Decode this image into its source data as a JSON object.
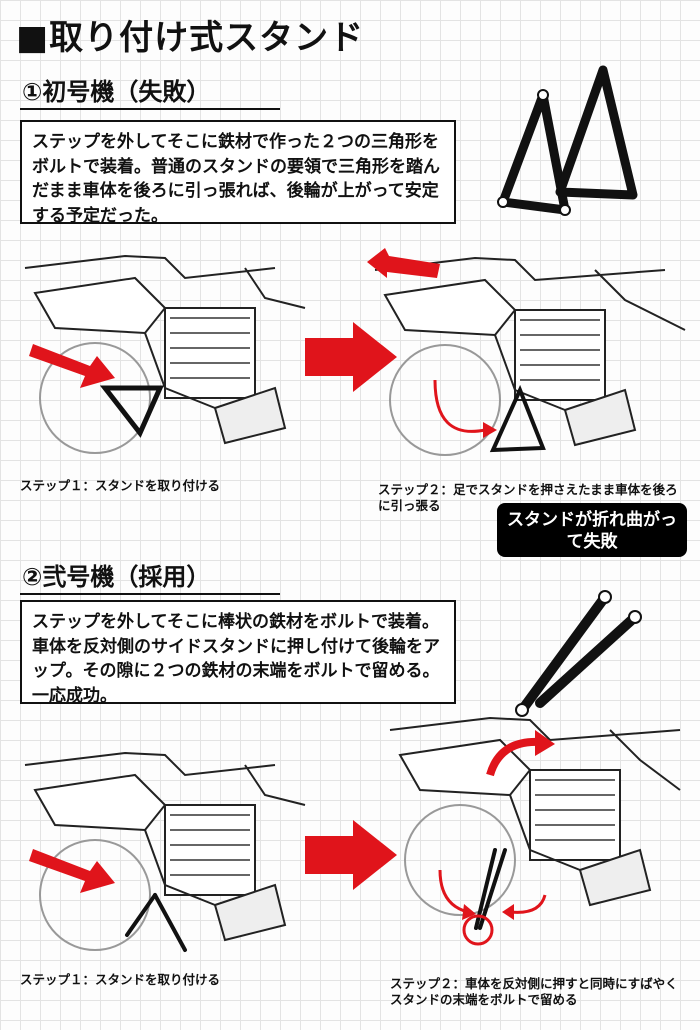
{
  "title": "■取り付け式スタンド",
  "section1": {
    "heading": "①初号機（失敗）",
    "description": "ステップを外してそこに鉄材で作った２つの三角形をボルトで装着。普通のスタンドの要領で三角形を踏んだまま車体を後ろに引っ張れば、後輪が上がって安定する予定だった。",
    "step1_caption": "ステップ１：スタンドを取り付ける",
    "step2_caption": "ステップ２：足でスタンドを押さえたまま車体を後ろに引っ張る",
    "failure_badge": "スタンドが折れ曲がって失敗"
  },
  "section2": {
    "heading": "②弐号機（採用）",
    "description": "ステップを外してそこに棒状の鉄材をボルトで装着。車体を反対側のサイドスタンドに押し付けて後輪をアップ。その隙に２つの鉄材の末端をボルトで留める。一応成功。",
    "step1_caption": "ステップ１：スタンドを取り付ける",
    "step2_caption": "ステップ２：車体を反対側に押すと同時にすばやくスタンドの末端をボルトで留める"
  },
  "colors": {
    "accent_red": "#e0141b",
    "ink": "#111111"
  }
}
